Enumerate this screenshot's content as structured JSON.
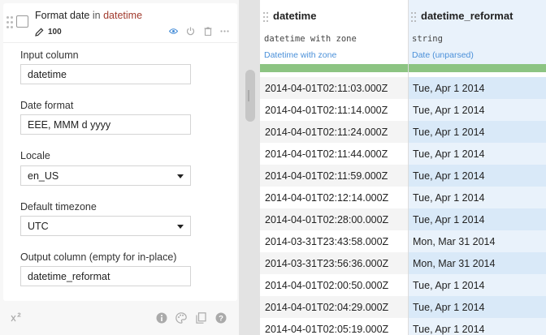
{
  "step": {
    "title_processor": "Format date",
    "title_in": " in ",
    "title_column": "datetime",
    "count": "100"
  },
  "form": {
    "input_column_label": "Input column",
    "input_column_value": "datetime",
    "date_format_label": "Date format",
    "date_format_value": "EEE, MMM d yyyy",
    "locale_label": "Locale",
    "locale_value": "en_US",
    "timezone_label": "Default timezone",
    "timezone_value": "UTC",
    "output_label": "Output column (empty for in-place)",
    "output_value": "datetime_reformat"
  },
  "table": {
    "columns": [
      {
        "name": "datetime",
        "storage_type": "datetime with zone",
        "meaning": "Datetime with zone"
      },
      {
        "name": "datetime_reformat",
        "storage_type": "string",
        "meaning": "Date (unparsed)"
      }
    ],
    "rows": [
      [
        "2014-04-01T02:11:03.000Z",
        "Tue, Apr 1 2014"
      ],
      [
        "2014-04-01T02:11:14.000Z",
        "Tue, Apr 1 2014"
      ],
      [
        "2014-04-01T02:11:24.000Z",
        "Tue, Apr 1 2014"
      ],
      [
        "2014-04-01T02:11:44.000Z",
        "Tue, Apr 1 2014"
      ],
      [
        "2014-04-01T02:11:59.000Z",
        "Tue, Apr 1 2014"
      ],
      [
        "2014-04-01T02:12:14.000Z",
        "Tue, Apr 1 2014"
      ],
      [
        "2014-04-01T02:28:00.000Z",
        "Tue, Apr 1 2014"
      ],
      [
        "2014-03-31T23:43:58.000Z",
        "Mon, Mar 31 2014"
      ],
      [
        "2014-03-31T23:56:36.000Z",
        "Mon, Mar 31 2014"
      ],
      [
        "2014-04-01T02:00:50.000Z",
        "Tue, Apr 1 2014"
      ],
      [
        "2014-04-01T02:04:29.000Z",
        "Tue, Apr 1 2014"
      ],
      [
        "2014-04-01T02:05:19.000Z",
        "Tue, Apr 1 2014"
      ]
    ]
  },
  "colors": {
    "processor_accent": "#a13a2d",
    "meaning_link": "#4a90d9",
    "validity_bar": "#8cc482",
    "selected_column": "#d9e9f8"
  },
  "icons": {
    "header": [
      "pencil-icon",
      "eye-icon",
      "power-icon",
      "trash-icon",
      "more-icon"
    ],
    "footer": [
      "formula-icon",
      "info-icon",
      "palette-icon",
      "copy-icon",
      "help-icon"
    ]
  }
}
